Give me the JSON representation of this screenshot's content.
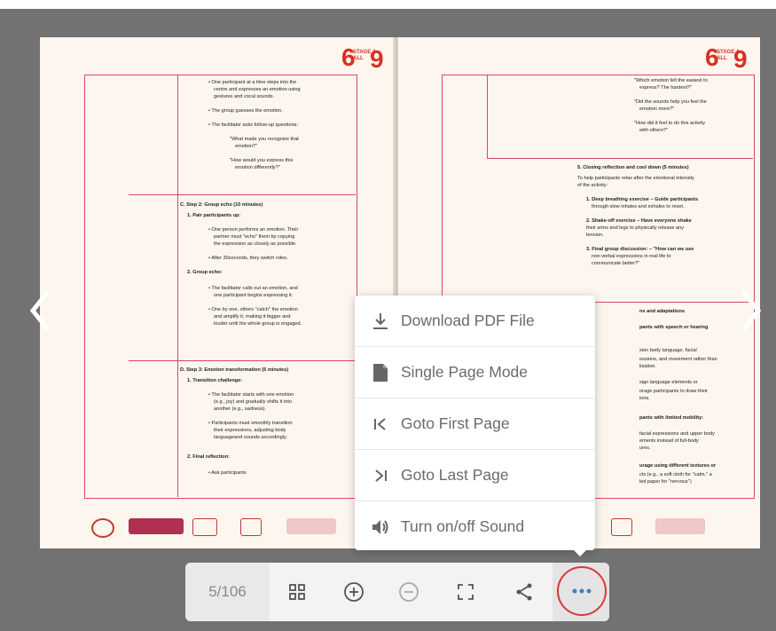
{
  "viewer": {
    "page_indicator": "5/106",
    "colors": {
      "accent": "#3b82c4",
      "highlight_ring": "#d93a3a",
      "frame": "#d8476a",
      "logo": "#d93025"
    }
  },
  "left_page": {
    "logo_text": "STAGE 4 ALL",
    "lines": [
      "• One participant at a time steps into the",
      "centre and expresses an emotion using",
      "gestures and vocal sounds.",
      "• The group guesses the emotion.",
      "• The facilitator asks follow-up questions:",
      "\"What made you recognize that",
      "emotion?\"",
      "\"How would you express this",
      "emotion differently?\"",
      "C. Step 2: Group echo (10 minutes)",
      "1. Pair participants up:",
      "• One person performs an emotion. Their",
      "partner must \"echo\" them by copying",
      "the expression as closely as possible.",
      "• After 30seconds, they switch roles.",
      "2. Group echo:",
      "• The facilitator calls out an emotion, and",
      "one participant begins expressing it.",
      "• One by one, others \"catch\" the emotion",
      "and amplify it, making it bigger and",
      "louder until the whole group is engaged.",
      "D. Step 3: Emotion transformation (5 minutes)",
      "1. Transition challenge:",
      "• The facilitator starts with one emotion",
      "(e.g., joy) and gradually shifts it into",
      "another (e.g., sadness).",
      "• Participants must smoothly transition",
      "their expressions, adjusting body",
      "languageand sounds accordingly.",
      "2. Final reflection:",
      "• Ask participants"
    ]
  },
  "right_page": {
    "logo_text": "STAGE 4 ALL",
    "lines": [
      "\"Which emotion felt the easiest to",
      "express? The hardest?\"",
      "\"Did the sounds help you feel the",
      "emotion more?\"",
      "\"How did it feel to do this activity",
      "with others?\"",
      "5. Closing reflection and cool down (5 minutes)",
      "To help participants relax after the emotional intensity",
      "of the activity:",
      "1. Deep breathing exercise – Guide participants",
      "through slow inhales and exhales to reset.",
      "2. Shake-off exercise – Have everyone shake",
      "their arms and legs to physically release any",
      "tension.",
      "3. Final group discussion: – \"How can we use",
      "non-verbal expressions in real life to",
      "communicate better?\"",
      "ns and adaptations",
      "pants with speech or hearing",
      "sion body language, facial",
      "essions, and movement rather than",
      "lization.",
      "sign language elements or",
      "orage participants to draw their",
      "ions.",
      "pants with limited mobility:",
      "facial expressions and upper body",
      "ements instead of full-body",
      "ures.",
      "urage using different textures or",
      "cts (e.g., a soft cloth for \"calm,\" a",
      "led paper for \"nervous\")"
    ]
  },
  "menu": {
    "items": [
      {
        "label": "Download PDF File",
        "icon": "download-icon"
      },
      {
        "label": "Single Page Mode",
        "icon": "document-icon"
      },
      {
        "label": "Goto First Page",
        "icon": "first-page-icon"
      },
      {
        "label": "Goto Last Page",
        "icon": "last-page-icon"
      },
      {
        "label": "Turn on/off Sound",
        "icon": "speaker-icon"
      }
    ]
  },
  "toolbar": {
    "buttons": [
      "thumbnails-icon",
      "zoom-in-icon",
      "zoom-out-icon",
      "fullscreen-icon",
      "share-icon",
      "more-icon"
    ]
  }
}
